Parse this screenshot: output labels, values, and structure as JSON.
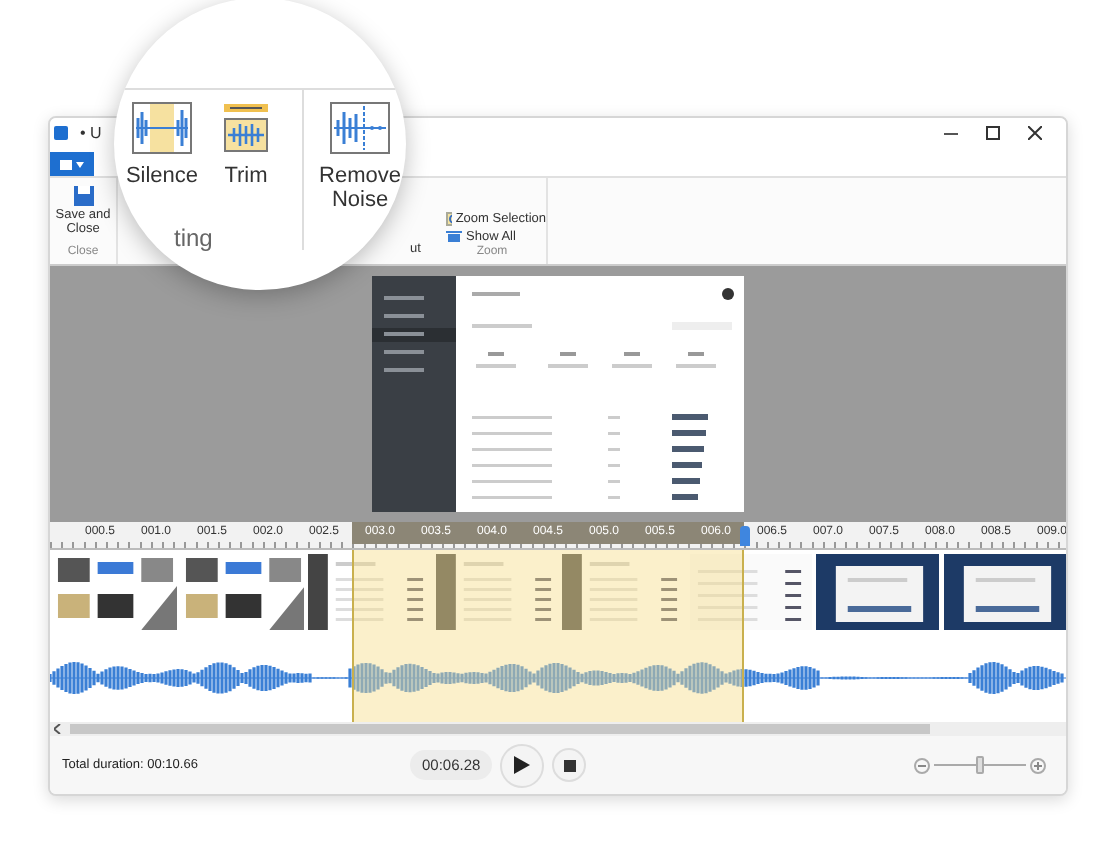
{
  "window": {
    "title": "• U"
  },
  "ribbon": {
    "close_group": {
      "button": "Save and Close",
      "label": "Close"
    },
    "hidden_group": {
      "button": "ut"
    },
    "zoom_group": {
      "items": [
        "Zoom Selection",
        "Show All"
      ],
      "label": "Zoom"
    }
  },
  "magnifier": {
    "buttons": [
      {
        "kind": "silence",
        "label": "Silence"
      },
      {
        "kind": "trim",
        "label": "Trim"
      },
      {
        "kind": "noise",
        "label": "Remove Noise"
      }
    ],
    "group_label": "ting"
  },
  "timeline": {
    "ticks": [
      {
        "label": "000.5",
        "selected": false
      },
      {
        "label": "001.0",
        "selected": false
      },
      {
        "label": "001.5",
        "selected": false
      },
      {
        "label": "002.0",
        "selected": false
      },
      {
        "label": "002.5",
        "selected": false
      },
      {
        "label": "003.0",
        "selected": true
      },
      {
        "label": "003.5",
        "selected": true
      },
      {
        "label": "004.0",
        "selected": true
      },
      {
        "label": "004.5",
        "selected": true
      },
      {
        "label": "005.0",
        "selected": true
      },
      {
        "label": "005.5",
        "selected": true
      },
      {
        "label": "006.0",
        "selected": true
      },
      {
        "label": "006.5",
        "selected": false
      },
      {
        "label": "007.0",
        "selected": false
      },
      {
        "label": "007.5",
        "selected": false
      },
      {
        "label": "008.0",
        "selected": false
      },
      {
        "label": "008.5",
        "selected": false
      },
      {
        "label": "009.0",
        "selected": false
      }
    ],
    "frames": [
      {
        "kind": "photos"
      },
      {
        "kind": "photos"
      },
      {
        "kind": "dashboard"
      },
      {
        "kind": "dashboard"
      },
      {
        "kind": "dashboard"
      },
      {
        "kind": "table"
      },
      {
        "kind": "dialog"
      },
      {
        "kind": "dialog"
      }
    ]
  },
  "player": {
    "total_duration": "Total duration: 00:10.66",
    "time": "00:06.28",
    "zoom": {
      "level": 0.5
    }
  }
}
